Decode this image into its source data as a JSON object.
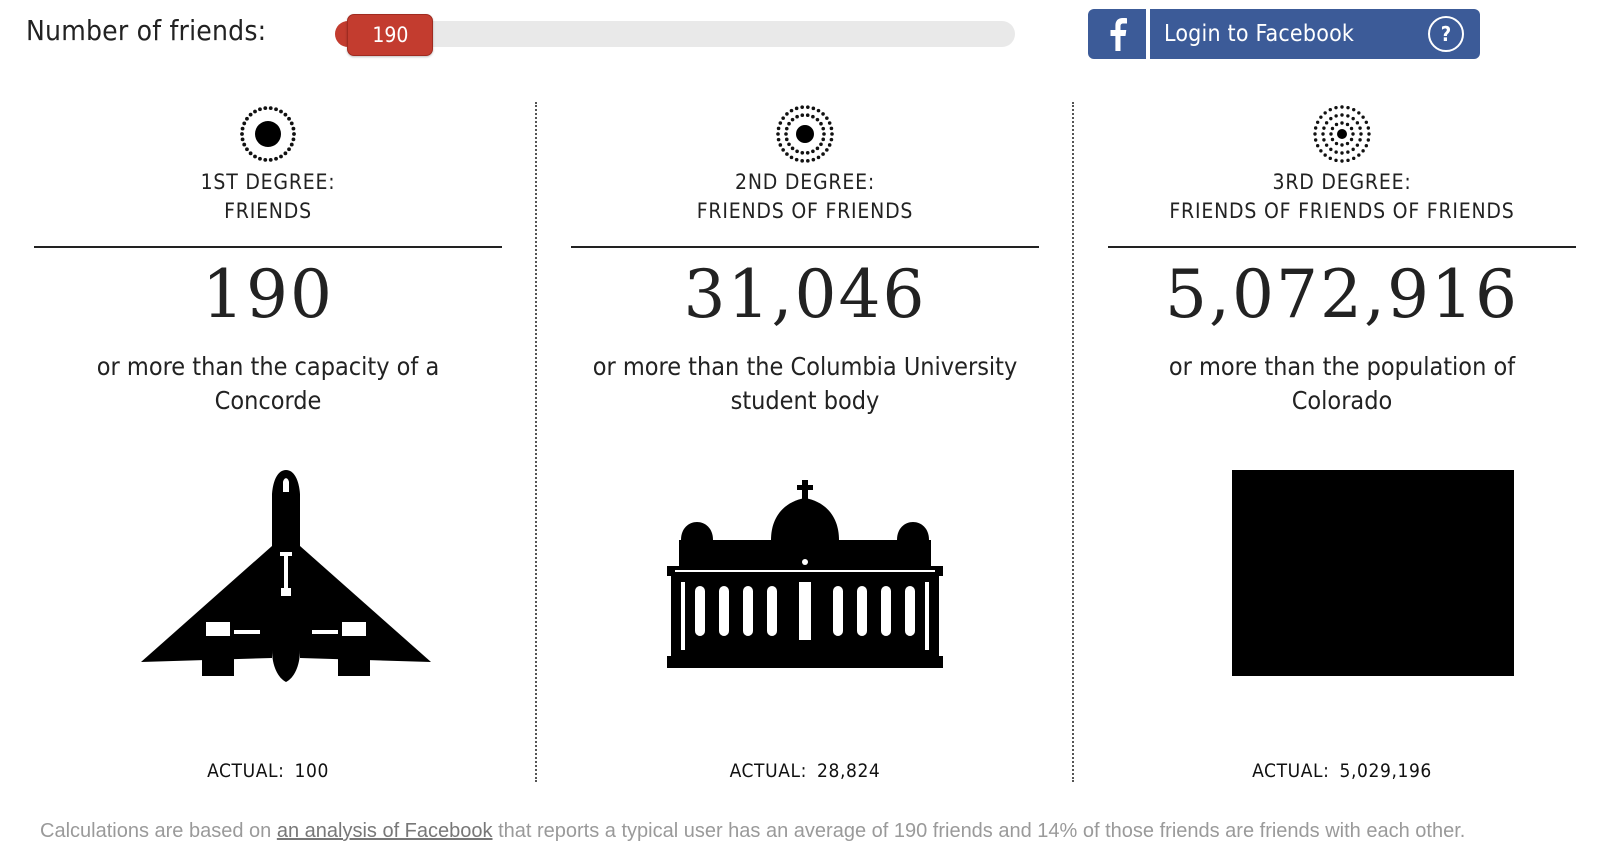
{
  "header": {
    "label": "Number of friends:",
    "slider": {
      "value": "190",
      "fill_fraction": 0.08
    },
    "facebook_button": {
      "label": "Login to Facebook",
      "help_glyph": "?",
      "color": "#3c5b98"
    }
  },
  "accent_color": "#c33c2f",
  "columns": [
    {
      "icon": "ring-dot-icon",
      "title_line1": "1ST DEGREE:",
      "title_line2": "FRIENDS",
      "count": "190",
      "comparison": "or more than the capacity of a Concorde",
      "illustration": "concorde-airplane",
      "actual_label": "ACTUAL:",
      "actual_value": "100"
    },
    {
      "icon": "double-ring-dot-icon",
      "title_line1": "2ND DEGREE:",
      "title_line2": "FRIENDS OF FRIENDS",
      "count": "31,046",
      "comparison": "or more than the Columbia University student body",
      "illustration": "university-building",
      "actual_label": "ACTUAL:",
      "actual_value": "28,824"
    },
    {
      "icon": "triple-ring-dot-icon",
      "title_line1": "3RD DEGREE:",
      "title_line2": "FRIENDS OF FRIENDS OF FRIENDS",
      "count": "5,072,916",
      "comparison": "or more than the population of Colorado",
      "illustration": "colorado-state-shape",
      "actual_label": "ACTUAL:",
      "actual_value": "5,029,196"
    }
  ],
  "footnote": {
    "before": "Calculations are based on ",
    "link": "an analysis of Facebook",
    "after": " that reports a typical user has an average of 190 friends and 14% of those friends are friends with each other."
  }
}
